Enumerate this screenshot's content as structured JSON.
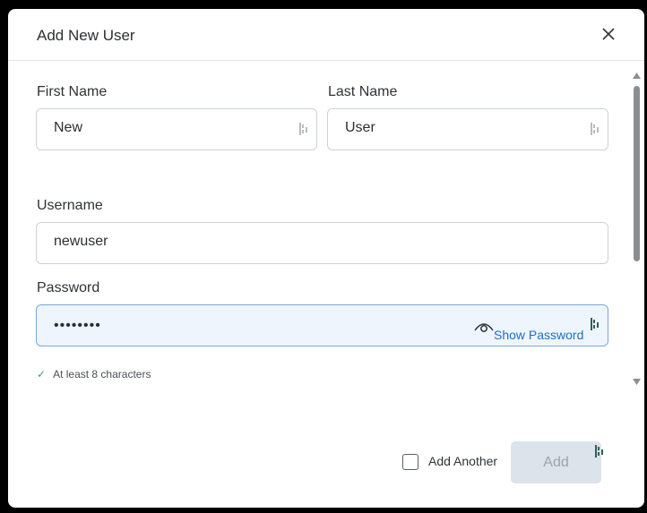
{
  "dialog": {
    "title": "Add New User",
    "close_icon": "close-icon"
  },
  "form": {
    "first_name": {
      "label": "First Name",
      "value": "New"
    },
    "last_name": {
      "label": "Last Name",
      "value": "User"
    },
    "username": {
      "label": "Username",
      "value": "newuser"
    },
    "password": {
      "label": "Password",
      "value": "••••••••",
      "show_label": "Show Password",
      "show_icon": "eye-icon"
    },
    "helper": {
      "icon": "check-icon",
      "text": "At least 8 characters"
    }
  },
  "footer": {
    "add_another_label": "Add Another",
    "add_another_checked": false,
    "add_button_label": "Add",
    "add_button_disabled": true
  },
  "colors": {
    "password_border": "#7aa8d8",
    "password_bg": "#eef5fd",
    "show_password_link": "#1f6fc2",
    "check": "#3aa86a",
    "keeper_icon": "#2f5f5a"
  }
}
